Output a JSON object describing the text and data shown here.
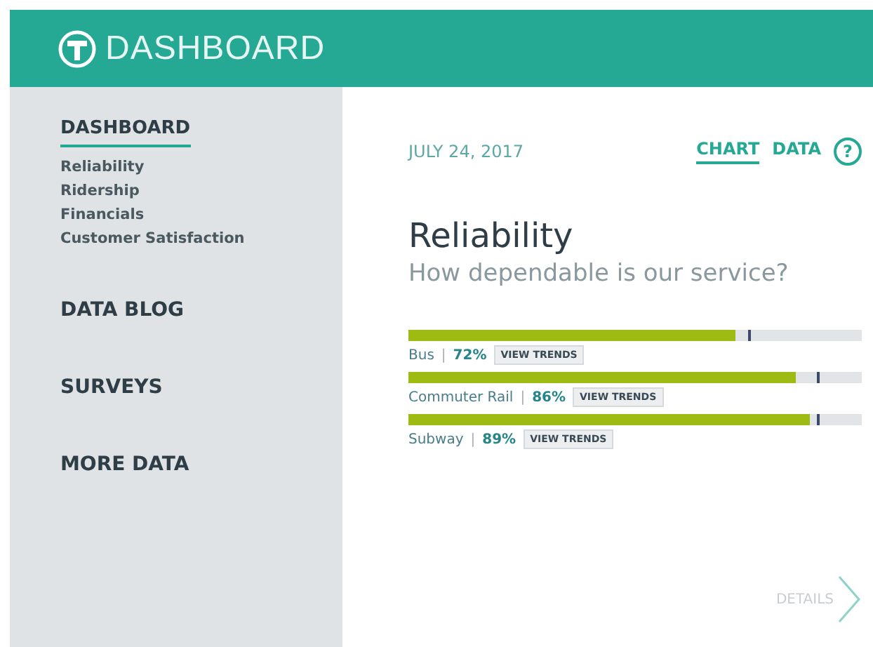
{
  "header": {
    "title": "DASHBOARD"
  },
  "sidebar": {
    "sections": [
      {
        "label": "DASHBOARD",
        "selected": true,
        "items": [
          "Reliability",
          "Ridership",
          "Financials",
          "Customer Satisfaction"
        ]
      },
      {
        "label": "DATA BLOG",
        "selected": false
      },
      {
        "label": "SURVEYS",
        "selected": false
      },
      {
        "label": "MORE DATA",
        "selected": false
      }
    ]
  },
  "content": {
    "date": "JULY 24, 2017",
    "views": [
      {
        "label": "CHART",
        "selected": true
      },
      {
        "label": "DATA",
        "selected": false
      }
    ],
    "help": "?",
    "title": "Reliability",
    "subtitle": "How dependable is our service?",
    "metrics": [
      {
        "name": "Bus",
        "separator": "|",
        "value": "72%",
        "level": 0.72,
        "target": {
          "level": 0.75
        },
        "button": "VIEW TRENDS"
      },
      {
        "name": "Commuter Rail",
        "separator": "|",
        "value": "86%",
        "level": 0.855,
        "target": {
          "level": 0.9
        },
        "button": "VIEW TRENDS"
      },
      {
        "name": "Subway",
        "separator": "|",
        "value": "89%",
        "level": 0.885,
        "target": {
          "level": 0.9
        },
        "button": "VIEW TRENDS"
      }
    ],
    "details": "DETAILS"
  }
}
